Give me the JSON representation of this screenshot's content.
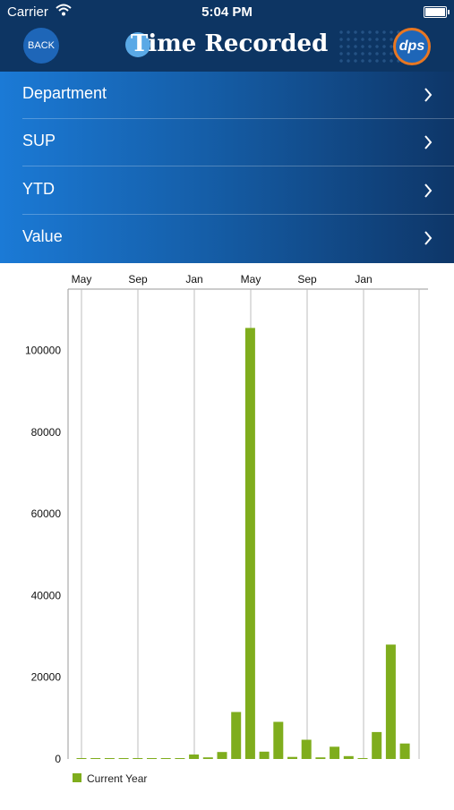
{
  "status_bar": {
    "carrier": "Carrier",
    "time": "5:04 PM"
  },
  "nav": {
    "back_label": "BACK",
    "title": "Time Recorded",
    "logo_text": "dps"
  },
  "menu": {
    "items": [
      {
        "label": "Department"
      },
      {
        "label": "SUP"
      },
      {
        "label": "YTD"
      },
      {
        "label": "Value"
      }
    ]
  },
  "colors": {
    "nav_bg": "#0d3563",
    "bar": "#7fad1d",
    "accent": "#1e66b8",
    "logo_ring": "#e87722"
  },
  "chart_data": {
    "type": "bar",
    "x_tick_labels": [
      "May",
      "Sep",
      "Jan",
      "May",
      "Sep",
      "Jan"
    ],
    "y_ticks": [
      0,
      20000,
      40000,
      60000,
      80000,
      100000
    ],
    "ylim": [
      0,
      115000
    ],
    "grid": "vertical",
    "legend": "bottom-left",
    "series": [
      {
        "name": "Current Year",
        "values": [
          100,
          0,
          0,
          0,
          0,
          0,
          150,
          150,
          1100,
          400,
          1700,
          11500,
          105500,
          1800,
          9100,
          500,
          4700,
          400,
          3000,
          700,
          100,
          6600,
          28000,
          3800
        ]
      }
    ]
  }
}
